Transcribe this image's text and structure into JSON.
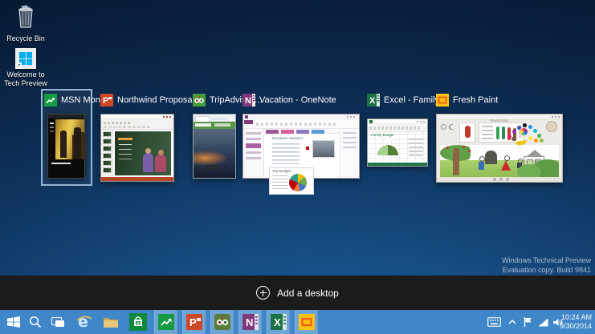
{
  "desktop": {
    "icons": [
      {
        "label": "Recycle Bin"
      },
      {
        "label": "Welcome to Tech Preview"
      }
    ],
    "watermark_line1": "Windows Technical Preview",
    "watermark_line2": "Evaluation copy. Build 9841"
  },
  "task_view": {
    "add_desktop_label": "Add a desktop",
    "windows": [
      {
        "title": "MSN Mon…",
        "app": "MSN Money",
        "selected": true
      },
      {
        "title": "Northwind Proposa…",
        "app": "PowerPoint",
        "selected": false
      },
      {
        "title": "TripAdvisor…",
        "app": "Internet Explorer",
        "selected": false
      },
      {
        "title": "Vacation - OneNote",
        "app": "OneNote",
        "selected": false
      },
      {
        "title": "Excel - Family…",
        "app": "Excel",
        "selected": false
      },
      {
        "title": "Fresh Paint",
        "app": "Fresh Paint",
        "selected": false
      }
    ],
    "thumbnail_text": {
      "onenote_page_title": "European Vacation",
      "onenote_box_title": "Trip Budget",
      "excel_chart_title": "Family Budget",
      "freshpaint_titlebar": "Fresh Paint"
    }
  },
  "taskbar": {
    "clock_time": "10:24 AM",
    "clock_date": "9/30/2014"
  },
  "colors": {
    "taskbar_blue": "#3F87C9",
    "bottom_bar": "#1B1B1B",
    "selection_border": "#A5C6E4",
    "msn_green": "#159C42",
    "powerpoint_orange": "#D04727",
    "tripadvisor_green": "#469B3A",
    "onenote_purple": "#80397B",
    "excel_green": "#1E7145",
    "freshpaint_yellow": "#FFC20E",
    "store_green": "#0E8A3D"
  }
}
